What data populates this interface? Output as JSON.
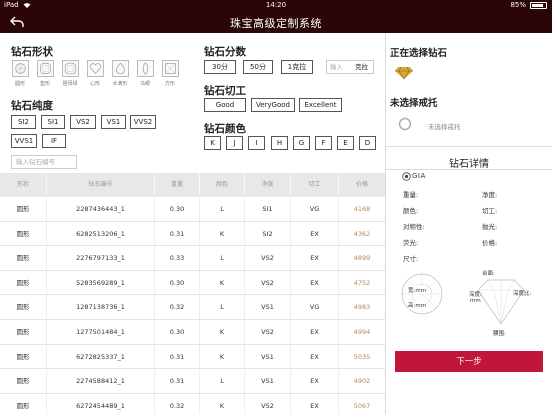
{
  "status_bar": {
    "device": "iPad",
    "wifi_icon": "wifi-icon",
    "time": "14:20",
    "battery": "85%",
    "battery_level": 0.85
  },
  "header": {
    "title": "珠宝高级定制系统",
    "back_icon": "back-arrow-icon"
  },
  "shape_section": {
    "title": "钻石形状",
    "shapes": [
      {
        "label": "圆形",
        "icon": "round-shape-icon"
      },
      {
        "label": "垫形",
        "icon": "cushion-shape-icon"
      },
      {
        "label": "祖母绿",
        "icon": "emerald-shape-icon"
      },
      {
        "label": "心形",
        "icon": "heart-shape-icon"
      },
      {
        "label": "水滴形",
        "icon": "pear-shape-icon"
      },
      {
        "label": "马眼",
        "icon": "marquise-shape-icon"
      },
      {
        "label": "方形",
        "icon": "princess-shape-icon"
      }
    ]
  },
  "clarity_section": {
    "title": "钻石纯度",
    "options": [
      "SI2",
      "SI1",
      "VS2",
      "VS1",
      "VVS2",
      "VVS1",
      "IF"
    ],
    "code_placeholder": "输入钻石编号"
  },
  "carat_section": {
    "title": "钻石分数",
    "options": [
      "30分",
      "50分",
      "1克拉"
    ],
    "input_placeholder": "输入",
    "unit": "克拉"
  },
  "cut_section": {
    "title": "钻石切工",
    "options": [
      "Good",
      "VeryGood",
      "Excellent"
    ]
  },
  "color_section": {
    "title": "钻石颜色",
    "options": [
      "K",
      "J",
      "I",
      "H",
      "G",
      "F",
      "E",
      "D"
    ]
  },
  "table": {
    "headers": [
      "形状",
      "钻石编号",
      "重量",
      "颜色",
      "净度",
      "切工",
      "价格"
    ],
    "rows": [
      [
        "圆形",
        "2287436443_1",
        "0.30",
        "L",
        "SI1",
        "VG",
        "4168"
      ],
      [
        "圆形",
        "6282513206_1",
        "0.31",
        "K",
        "SI2",
        "EX",
        "4362"
      ],
      [
        "圆形",
        "2276797133_1",
        "0.33",
        "L",
        "VS2",
        "EX",
        "4899"
      ],
      [
        "圆形",
        "5283569289_1",
        "0.30",
        "K",
        "VS2",
        "EX",
        "4752"
      ],
      [
        "圆形",
        "1287138736_1",
        "0.32",
        "L",
        "VS1",
        "VG",
        "4983"
      ],
      [
        "圆形",
        "1277501484_1",
        "0.30",
        "K",
        "VS2",
        "EX",
        "4994"
      ],
      [
        "圆形",
        "6272825337_1",
        "0.31",
        "K",
        "VS1",
        "EX",
        "5035"
      ],
      [
        "圆形",
        "2274588412_1",
        "0.31",
        "L",
        "VS1",
        "EX",
        "4902"
      ],
      [
        "圆形",
        "6272454489_1",
        "0.32",
        "K",
        "VS2",
        "EX",
        "5067"
      ]
    ]
  },
  "selection": {
    "diamond_title": "正在选择钻石",
    "ring_title": "未选择戒托",
    "ring_sub": "未选择戒托",
    "diamond_icon": "diamond-icon",
    "ring_icon": "ring-icon"
  },
  "details": {
    "title": "钻石详情",
    "gia": "GIA",
    "gia_icon": "gia-seal-icon",
    "fields": [
      "重量:",
      "净度:",
      "颜色:",
      "切工:",
      "对称性:",
      "抛光:",
      "荧光:",
      "价格:",
      "尺寸:"
    ],
    "diagram": {
      "width": "宽:mm",
      "height": "高:mm",
      "table_label": "台面:",
      "depth": "深度:",
      "mm": "mm",
      "depth_ratio": "深度比:",
      "girdle": "腰围:"
    },
    "next_button": "下一步"
  },
  "colors": {
    "header_bg": "#2a0606",
    "accent": "#c0163a",
    "price": "#b48a52"
  }
}
